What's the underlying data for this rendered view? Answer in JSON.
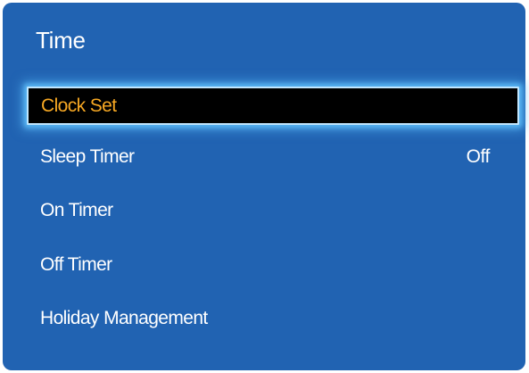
{
  "menu": {
    "title": "Time",
    "items": [
      {
        "label": "Clock Set",
        "value": "",
        "focused": true
      },
      {
        "label": "Sleep Timer",
        "value": "Off",
        "focused": false
      },
      {
        "label": "On Timer",
        "value": "",
        "focused": false
      },
      {
        "label": "Off Timer",
        "value": "",
        "focused": false
      },
      {
        "label": "Holiday Management",
        "value": "",
        "focused": false
      }
    ]
  },
  "colors": {
    "panel_background": "#2163b2",
    "text": "#ffffff",
    "focus_background": "#000000",
    "focus_text": "#f7a823",
    "focus_glow": "#5ab8f5"
  }
}
